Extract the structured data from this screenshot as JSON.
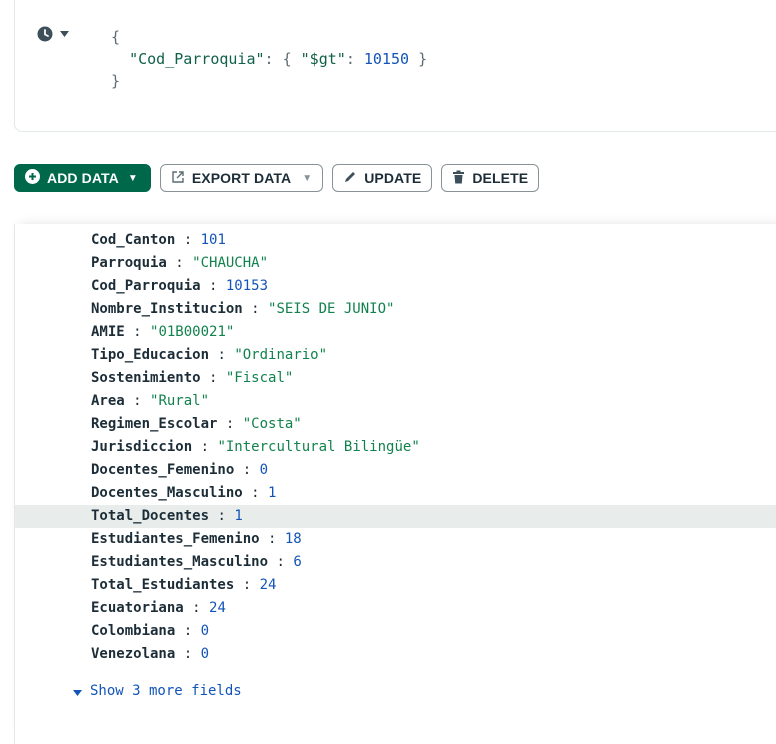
{
  "query": {
    "open_brace": "{",
    "key": "\"Cod_Parroquia\"",
    "colon": ":",
    "inner_open": "{",
    "op": "\"$gt\"",
    "op_colon": ":",
    "value": "10150",
    "inner_close": "}",
    "close_brace": "}"
  },
  "toolbar": {
    "add_data": "ADD DATA",
    "export_data": "EXPORT DATA",
    "update": "UPDATE",
    "delete": "DELETE"
  },
  "document": {
    "fields": [
      {
        "key": "Cod_Canton",
        "value": "101",
        "type": "number"
      },
      {
        "key": "Parroquia",
        "value": "\"CHAUCHA\"",
        "type": "string"
      },
      {
        "key": "Cod_Parroquia",
        "value": "10153",
        "type": "number"
      },
      {
        "key": "Nombre_Institucion",
        "value": "\"SEIS DE JUNIO\"",
        "type": "string"
      },
      {
        "key": "AMIE",
        "value": "\"01B00021\"",
        "type": "string"
      },
      {
        "key": "Tipo_Educacion",
        "value": "\"Ordinario\"",
        "type": "string"
      },
      {
        "key": "Sostenimiento",
        "value": "\"Fiscal\"",
        "type": "string"
      },
      {
        "key": "Area",
        "value": "\"Rural\"",
        "type": "string"
      },
      {
        "key": "Regimen_Escolar",
        "value": "\"Costa\"",
        "type": "string"
      },
      {
        "key": "Jurisdiccion",
        "value": "\"Intercultural Bilingüe\"",
        "type": "string"
      },
      {
        "key": "Docentes_Femenino",
        "value": "0",
        "type": "number"
      },
      {
        "key": "Docentes_Masculino",
        "value": "1",
        "type": "number"
      },
      {
        "key": "Total_Docentes",
        "value": "1",
        "type": "number"
      },
      {
        "key": "Estudiantes_Femenino",
        "value": "18",
        "type": "number"
      },
      {
        "key": "Estudiantes_Masculino",
        "value": "6",
        "type": "number"
      },
      {
        "key": "Total_Estudiantes",
        "value": "24",
        "type": "number"
      },
      {
        "key": "Ecuatoriana",
        "value": "24",
        "type": "number"
      },
      {
        "key": "Colombiana",
        "value": "0",
        "type": "number"
      },
      {
        "key": "Venezolana",
        "value": "0",
        "type": "number"
      }
    ],
    "separator": " : ",
    "show_more": "Show 3 more fields"
  },
  "colors": {
    "primary": "#00684a",
    "number": "#1254b7",
    "string": "#12824d",
    "highlight_row": "#e8edeb"
  },
  "icons": [
    "history-icon",
    "chevron-down-icon",
    "plus-circle-icon",
    "export-icon",
    "pencil-icon",
    "trash-icon",
    "caret-down-icon"
  ]
}
